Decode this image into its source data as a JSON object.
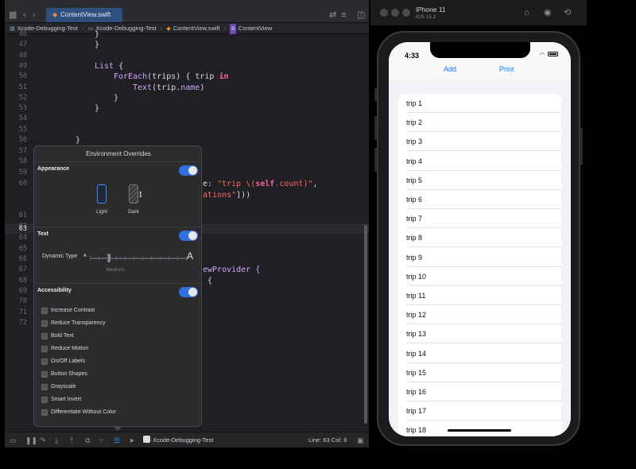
{
  "xcode": {
    "tab_title": "ContentView.swift",
    "breadcrumb": [
      "Xcode-Debugging-Test",
      "Xcode-Debugging-Test",
      "ContentView.swift",
      "ContentView"
    ],
    "line_numbers": [
      "46",
      "47",
      "48",
      "49",
      "50",
      "51",
      "52",
      "53",
      "54",
      "55",
      "56",
      "57",
      "58",
      "59",
      "60",
      "",
      "61",
      "62",
      "63",
      "64",
      "65",
      "66",
      "67",
      "68",
      "69",
      "70",
      "71",
      "72"
    ],
    "current_line": "63",
    "code": {
      "l46": "}",
      "l47": "}",
      "l49_kw": "List",
      "l49_rest": " {",
      "l50_kw": "ForEach",
      "l50_rest": "(trips) { trip ",
      "l50_in": "in",
      "l51_kw": "Text",
      "l51_rest": "(trip.",
      "l51_prop": "name",
      "l51_end": ")",
      "l52": "}",
      "l53": "}",
      "l56": "}",
      "l60_a": "e: ",
      "l60_str": "\"trip \\(",
      "l60_self": "self",
      "l60_str2": ".count)\"",
      "l60_end": ",",
      "l60b_str": "ations\"",
      "l60b_end": "]))",
      "l67": "ewProvider {",
      "l68": "{"
    },
    "debug": {
      "scheme": "Xcode-Debugging-Test",
      "line_col": "Line: 63  Col: 6"
    }
  },
  "overrides": {
    "title": "Environment Overrides",
    "appearance": {
      "title": "Appearance",
      "enabled": true,
      "light_label": "Light",
      "dark_label": "Dark"
    },
    "text": {
      "title": "Text",
      "enabled": true,
      "dynamic_type_label": "Dynamic Type",
      "small_a": "A",
      "large_a": "A",
      "value_label": "Medium",
      "slider_position": 0.2
    },
    "accessibility": {
      "title": "Accessibility",
      "enabled": true,
      "options": [
        "Increase Contrast",
        "Reduce Transparency",
        "Bold Text",
        "Reduce Motion",
        "On/Off Labels",
        "Button Shapes",
        "Grayscale",
        "Smart Invert",
        "Differentiate Without Color"
      ]
    }
  },
  "simulator": {
    "device": "iPhone 11",
    "os": "iOS 15.2",
    "status_time": "4:33",
    "nav": {
      "add": "Add",
      "print": "Print"
    },
    "trips": [
      "trip 1",
      "trip 2",
      "trip 3",
      "trip 4",
      "trip 5",
      "trip 6",
      "trip 7",
      "trip 8",
      "trip 9",
      "trip 10",
      "trip 11",
      "trip 12",
      "trip 13",
      "trip 14",
      "trip 15",
      "trip 16",
      "trip 17",
      "trip 18"
    ]
  },
  "colors": {
    "accent_blue": "#3d8cf0",
    "ios_blue": "#0a7aff",
    "keyword_pink": "#fc5fa3",
    "string_red": "#fc6a5d"
  }
}
